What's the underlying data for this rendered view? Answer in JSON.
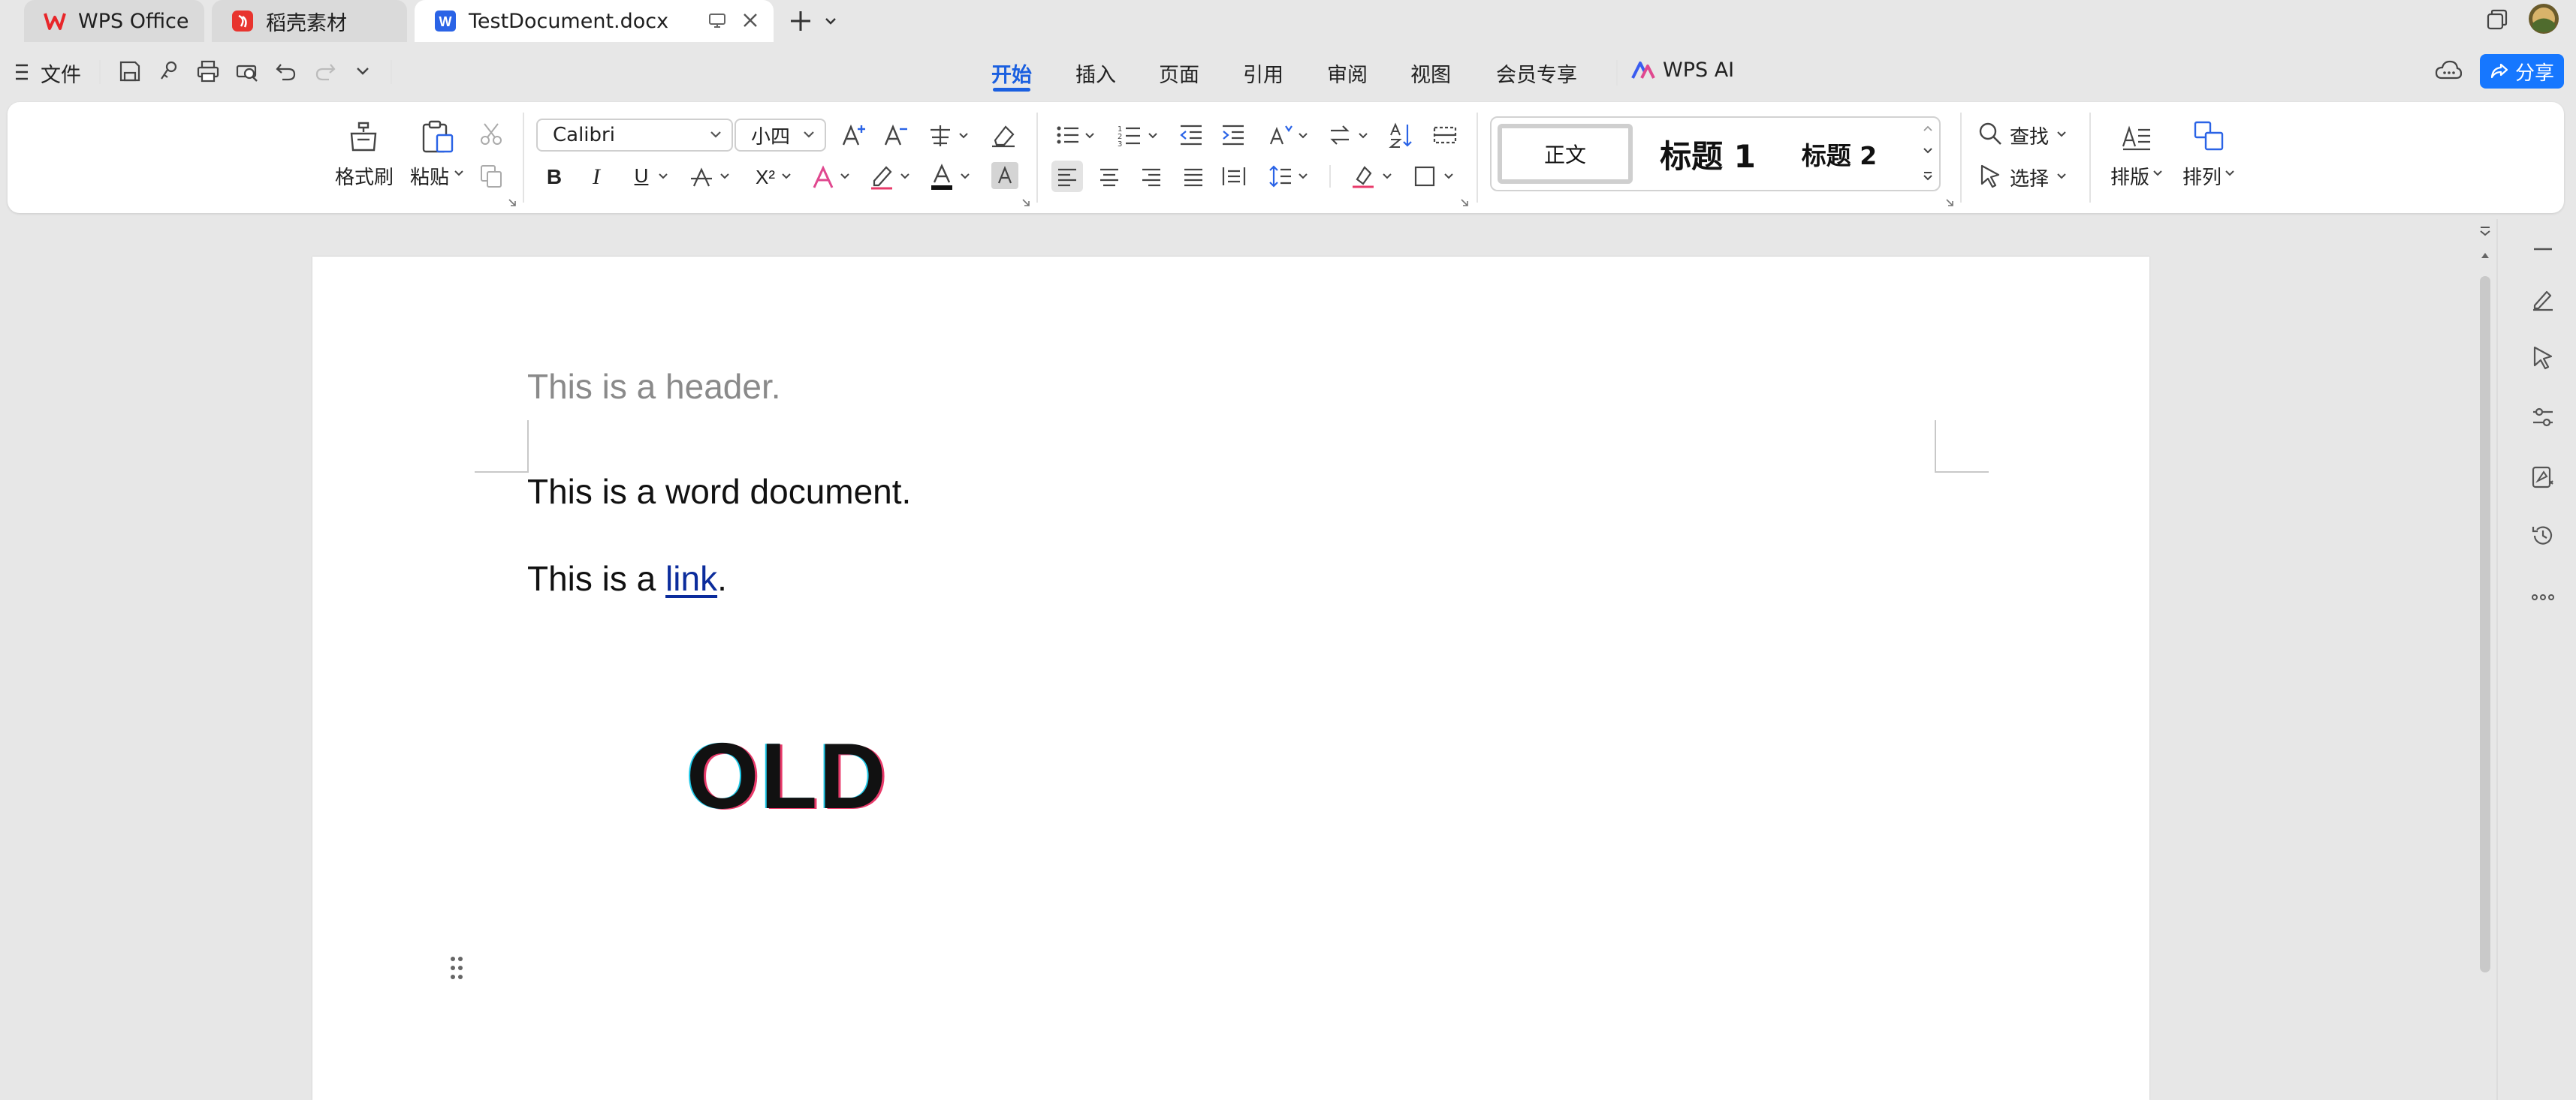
{
  "tabs": [
    {
      "label": "WPS Office",
      "icon": "wps-logo-icon"
    },
    {
      "label": "稻壳素材",
      "icon": "docer-logo-icon"
    },
    {
      "label": "TestDocument.docx",
      "icon": "writer-logo-icon"
    }
  ],
  "menu": {
    "file_label": "文件",
    "tabs": [
      "开始",
      "插入",
      "页面",
      "引用",
      "审阅",
      "视图",
      "会员专享"
    ],
    "active_tab": "开始",
    "ai_label": "WPS AI",
    "share_label": "分享"
  },
  "ribbon": {
    "format_painter_label": "格式刷",
    "paste_label": "粘贴",
    "font_name": "Calibri",
    "font_size": "小四",
    "styles": {
      "normal": "正文",
      "heading1": "标题 1",
      "heading2": "标题 2"
    },
    "find_label": "查找",
    "select_label": "选择",
    "layout_label": "排版",
    "arrange_label": "排列",
    "superscript_glyph": "X²",
    "bold_glyph": "B",
    "italic_glyph": "I",
    "underline_glyph": "U"
  },
  "document": {
    "header": "This is a header.",
    "line1": "This is a word document.",
    "line2_prefix": "This is a ",
    "link_text": "link",
    "line2_suffix": ".",
    "wordart": "OLD"
  },
  "colors": {
    "accent": "#1a5fe0",
    "link": "#0b2c9c",
    "share_button": "#1677ff",
    "wps_logo": "#e8262a",
    "writer_logo": "#2a63e6"
  }
}
